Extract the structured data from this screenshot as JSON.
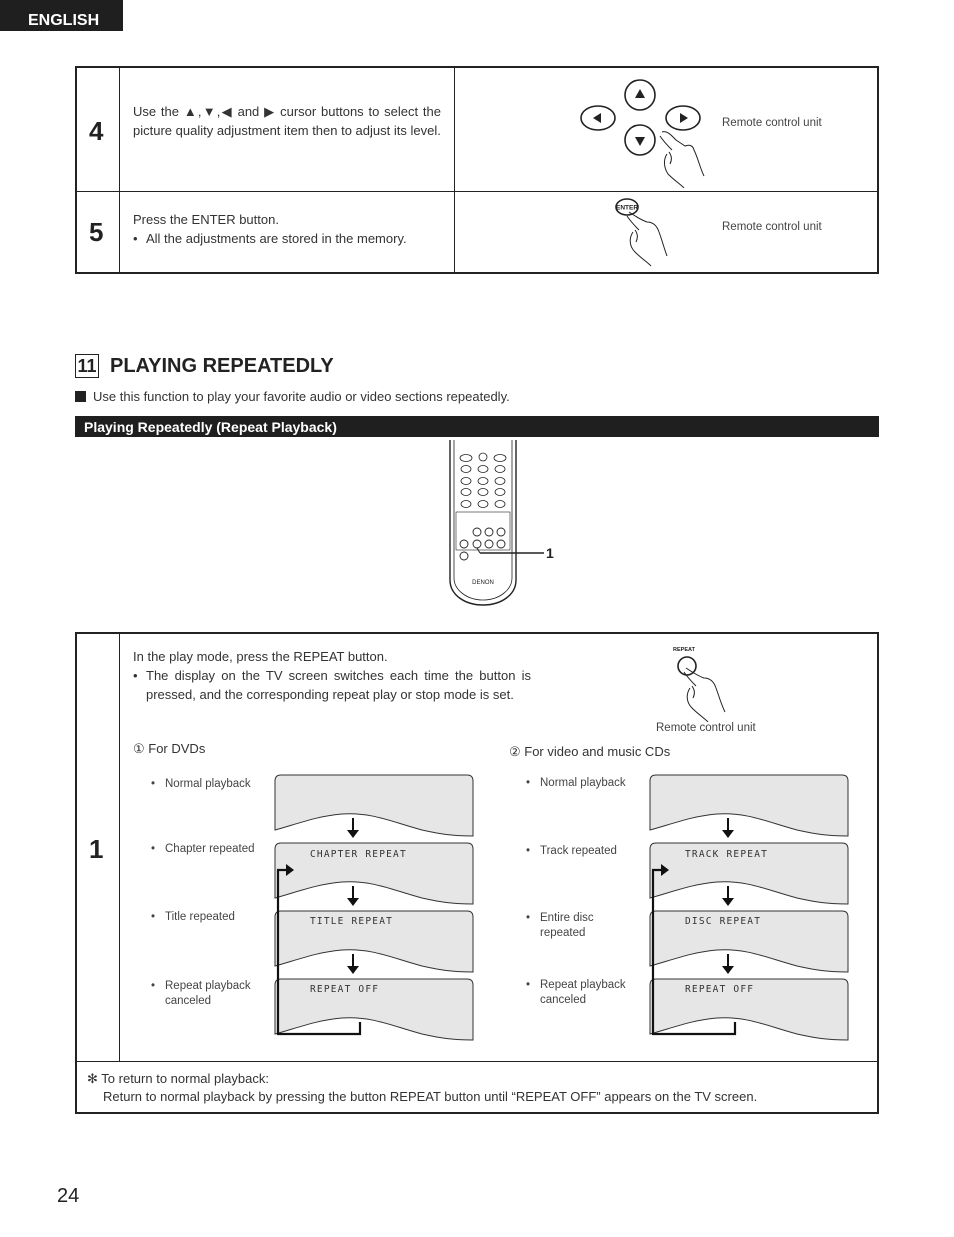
{
  "header": {
    "language_tab": "ENGLISH"
  },
  "steps_top": [
    {
      "number": "4",
      "text": "Use the ▲,▼,◀ and ▶ cursor buttons to select the picture quality adjustment item then to adjust its level.",
      "illustration_label": "Remote control unit",
      "illustration": "cursor-buttons-with-hand"
    },
    {
      "number": "5",
      "text": "Press the ENTER button.",
      "bullet": "All the adjustments are stored in the memory.",
      "illustration_label": "Remote control unit",
      "button_label": "ENTER",
      "illustration": "enter-button-with-hand"
    }
  ],
  "section": {
    "number": "11",
    "title": "PLAYING REPEATEDLY",
    "intro": "Use this function to play your favorite audio or video sections repeatedly.",
    "subheading": "Playing Repeatedly (Repeat Playback)",
    "remote_callout": "1",
    "remote_brand": "DENON"
  },
  "step_main": {
    "number": "1",
    "text": "In the play mode, press the REPEAT button.",
    "bullet": "The display on the TV screen switches each time the button is pressed, and the corresponding repeat play  or stop mode is set.",
    "button_label": "REPEAT",
    "illustration_label": "Remote control unit",
    "dvd": {
      "title": "① For DVDs",
      "items": [
        {
          "label": "Normal playback",
          "screen": ""
        },
        {
          "label": "Chapter repeated",
          "screen": "CHAPTER REPEAT"
        },
        {
          "label": "Title repeated",
          "screen": "TITLE REPEAT"
        },
        {
          "label": "Repeat playback canceled",
          "screen": "REPEAT OFF"
        }
      ]
    },
    "cd": {
      "title": "② For video and music CDs",
      "items": [
        {
          "label": "Normal playback",
          "screen": ""
        },
        {
          "label": "Track repeated",
          "screen": "TRACK REPEAT"
        },
        {
          "label": "Entire disc repeated",
          "screen": "DISC REPEAT"
        },
        {
          "label": "Repeat playback canceled",
          "screen": "REPEAT OFF"
        }
      ]
    }
  },
  "footnote": {
    "marker": "✻",
    "title": "To return to normal playback:",
    "text": "Return to normal playback by pressing the button REPEAT button until “REPEAT OFF” appears on the TV screen."
  },
  "page_number": "24",
  "colors": {
    "header_bg": "#1f1f1f",
    "screen_fill": "#e6e6e6",
    "rule": "#222222"
  }
}
